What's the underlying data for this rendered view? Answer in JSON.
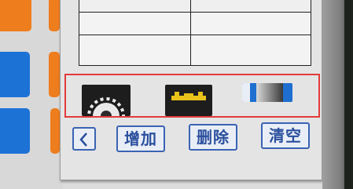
{
  "toolbar": {
    "back_icon": "chevron-left-icon",
    "add_label": "增加",
    "delete_label": "删除",
    "clear_label": "清空"
  },
  "thumbnails": [
    {
      "icon": "gear-icon"
    },
    {
      "icon": "device-icon"
    },
    {
      "icon": "gradient-icon"
    }
  ],
  "colors": {
    "left_tile_orange": "#ee7d1e",
    "left_tile_blue": "#1d72d6",
    "selection_outline": "#e23a3a",
    "button_border": "#3a63b4"
  }
}
